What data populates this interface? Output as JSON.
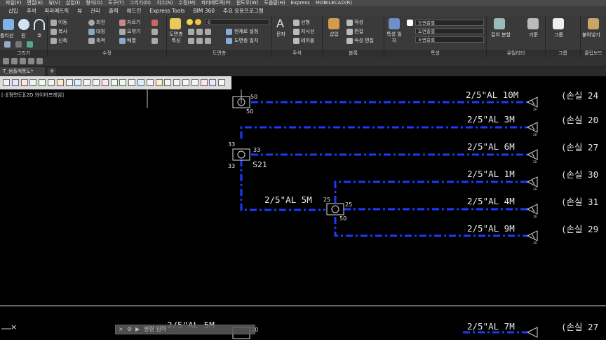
{
  "menu": [
    "파일(F)",
    "편집(E)",
    "뷰(V)",
    "삽입(I)",
    "형식(O)",
    "도구(T)",
    "그리기(D)",
    "치수(N)",
    "수정(M)",
    "파라메트릭(P)",
    "윈도우(W)",
    "도움말(H)",
    "Express",
    "MOBILECAD(R)"
  ],
  "ribbon_tabs": [
    "삽입",
    "주석",
    "파라메트릭",
    "뷰",
    "관리",
    "출력",
    "애드인",
    "Express Tools",
    "BIM 360",
    "주요 응용프로그램"
  ],
  "panels": {
    "draw": {
      "title": "그리기",
      "line": "폴리선",
      "circle": "원",
      "arc": "호"
    },
    "modify": {
      "title": "수정",
      "items": [
        "이동",
        "회전",
        "자르기",
        "복사",
        "대칭",
        "모깎기",
        "신축",
        "축척",
        "배열"
      ]
    },
    "layers": {
      "title": "도면층",
      "btn1": "도면층 특성",
      "btn2": "현재로 설정",
      "btn3": "도면층 일치",
      "combo": "0"
    },
    "annotation": {
      "title": "주석",
      "text": "문자",
      "items": [
        "선형",
        "지시선",
        "테이블"
      ]
    },
    "block": {
      "title": "블록",
      "insert": "삽입",
      "items": [
        "작성",
        "편집",
        "속성 편집"
      ]
    },
    "properties": {
      "title": "특성",
      "match": "특성 일치",
      "combo1": "도면층별",
      "combo2": "도면층별",
      "combo3": "도면층별"
    },
    "utilities": {
      "title": "유틸리티",
      "measure": "길이 분할",
      "base": "기준"
    },
    "groups": {
      "title": "그룹",
      "group": "그룹"
    },
    "clipboard": {
      "title": "클립보드",
      "paste": "붙여넣기"
    }
  },
  "doc_tab": "T_샘플계통도*",
  "new_tab": "+",
  "viewport_label": "[-][평면도][2D 와이어프레임]",
  "drawing": {
    "labels": [
      {
        "text": "2/5\"AL 10M"
      },
      {
        "text": "2/5\"AL 3M"
      },
      {
        "text": "2/5\"AL 6M"
      },
      {
        "text": "2/5\"AL 1M"
      },
      {
        "text": "2/5\"AL 4M"
      },
      {
        "text": "2/5\"AL 9M"
      },
      {
        "text": "2/5\"AL 5M"
      },
      {
        "text": "2/5\"AL 7M"
      },
      {
        "text": "2/5\"AL 5M"
      }
    ],
    "rooms": [
      "(손실 24",
      "(손실 20",
      "(손실 27",
      "(손실 30",
      "(손실 31",
      "(손실 29",
      "(손실 27"
    ],
    "nodes": {
      "n1": "50",
      "n1b": "50",
      "n2a": "33",
      "n2b": "33",
      "n2c": "33",
      "n2d": "S21",
      "n3a": "25",
      "n3b": "25",
      "n3c": "50",
      "n4": "20"
    }
  },
  "command_line": "명령 입력",
  "ucs": "×"
}
